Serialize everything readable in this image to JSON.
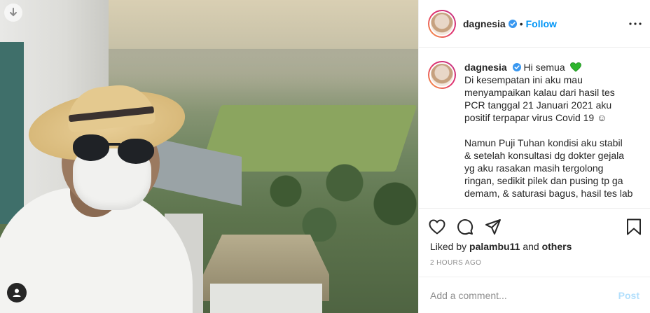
{
  "header": {
    "username": "dagnesia",
    "separator": "•",
    "follow_label": "Follow"
  },
  "caption": {
    "username": "dagnesia",
    "lines": [
      "Hi semua",
      "Di kesempatan ini aku mau",
      "menyampaikan kalau dari hasil tes",
      "PCR tanggal 21 Januari 2021 aku",
      "positif terpapar virus Covid 19 ☺",
      "",
      "Namun Puji Tuhan kondisi aku stabil",
      "& setelah konsultasi dg dokter gejala",
      "yg aku rasakan masih tergolong",
      "ringan, sedikit pilek dan pusing tp ga",
      "demam, & saturasi bagus, hasil tes lab"
    ]
  },
  "likes": {
    "prefix": "Liked by",
    "user": "palambu11",
    "conjunction": "and",
    "others": "others"
  },
  "timestamp": "2 HOURS AGO",
  "comment": {
    "placeholder": "Add a comment...",
    "post_label": "Post"
  },
  "colors": {
    "accent_blue": "#0095f6",
    "post_disabled": "#b2dffc",
    "muted": "#8e8e8e",
    "green_heart": "#2db52d"
  }
}
